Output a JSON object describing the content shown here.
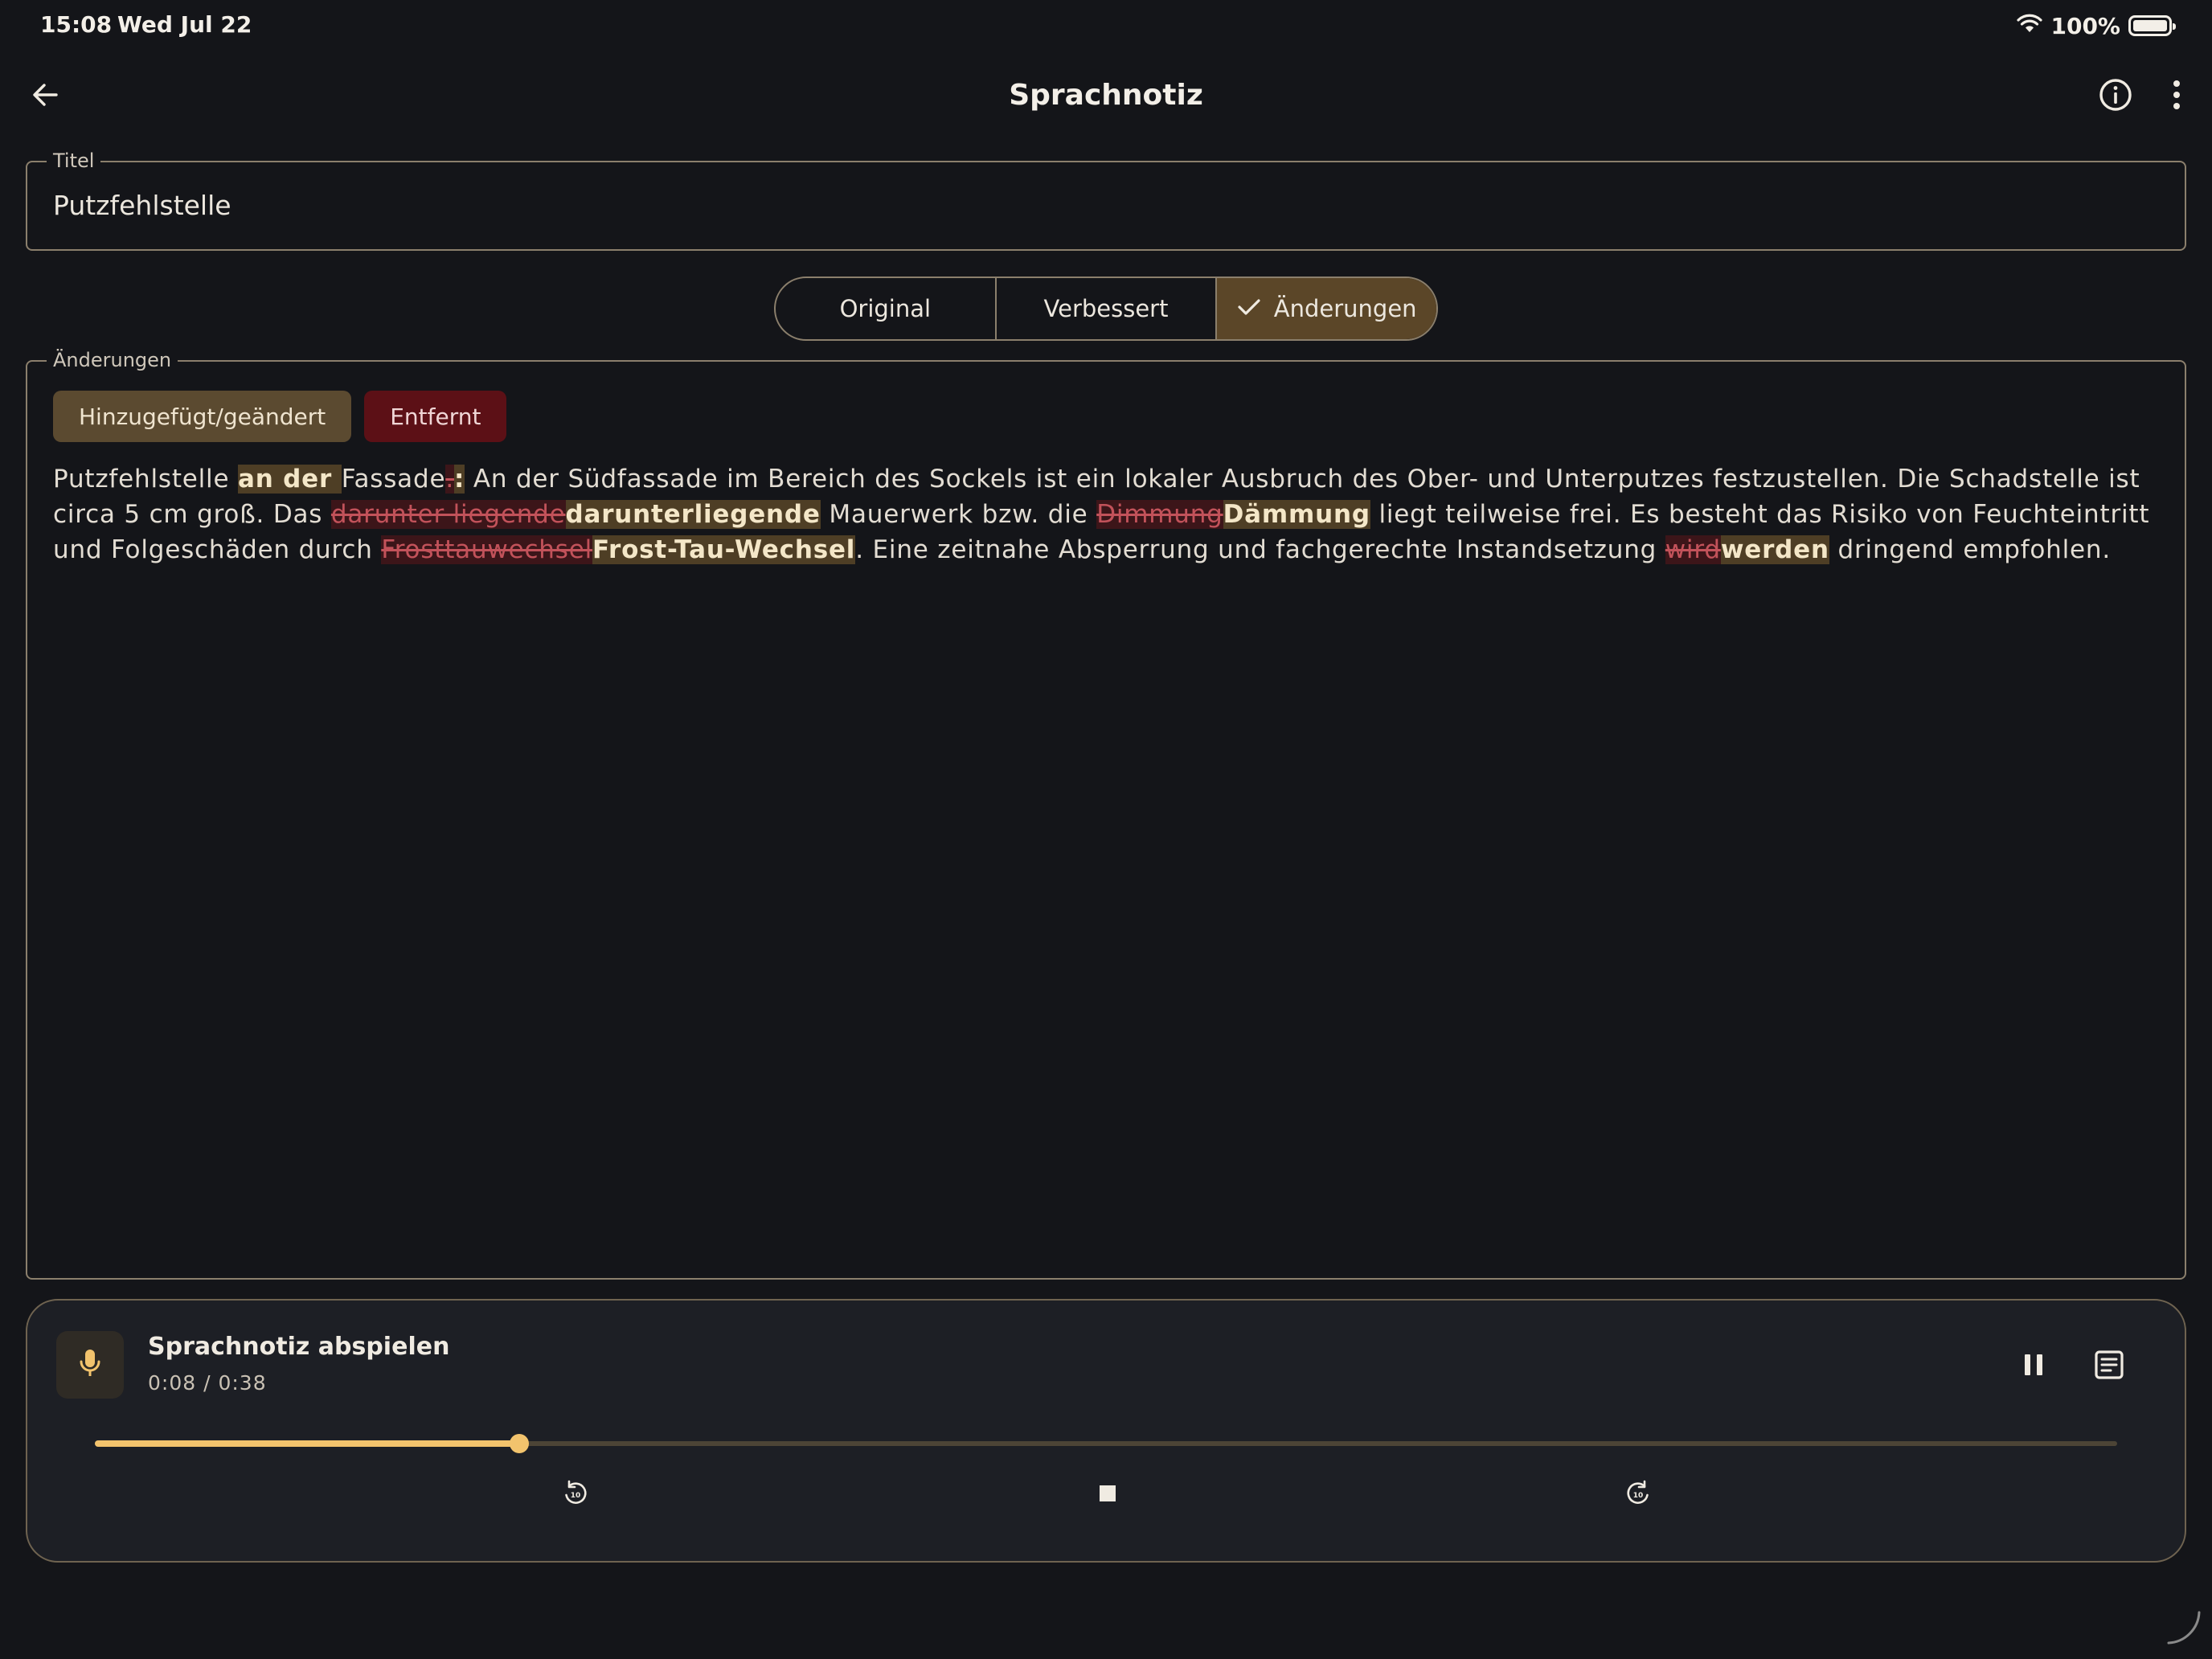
{
  "status_bar": {
    "time": "15:08",
    "date": "Wed Jul 22",
    "battery": "100%",
    "icons": [
      "wifi-icon",
      "battery-icon"
    ]
  },
  "app_bar": {
    "title": "Sprachnotiz",
    "icons": [
      "back-arrow-icon",
      "info-icon",
      "more-vertical-icon"
    ]
  },
  "title_field": {
    "label": "Titel",
    "value": "Putzfehlstelle"
  },
  "view_toggle": {
    "segments": [
      {
        "label": "Original",
        "selected": false
      },
      {
        "label": "Verbessert",
        "selected": false
      },
      {
        "label": "Änderungen",
        "selected": true
      }
    ]
  },
  "changes": {
    "label": "Änderungen",
    "legend": {
      "added": "Hinzugefügt/geändert",
      "removed": "Entfernt"
    },
    "segments": [
      {
        "type": "eq",
        "text": "Putzfehlstelle "
      },
      {
        "type": "ins",
        "text": "an der "
      },
      {
        "type": "eq",
        "text": "Fassade"
      },
      {
        "type": "del",
        "text": "."
      },
      {
        "type": "ins",
        "text": ":"
      },
      {
        "type": "eq",
        "text": " An der Südfassade im Bereich des Sockels ist ein lokaler Ausbruch des Ober- und Unterputzes festzustellen. Die Schadstelle ist circa 5 cm groß. Das "
      },
      {
        "type": "del",
        "text": "darunter liegende"
      },
      {
        "type": "ins",
        "text": "darunterliegende"
      },
      {
        "type": "eq",
        "text": " Mauerwerk bzw. die "
      },
      {
        "type": "del",
        "text": "Dimmung"
      },
      {
        "type": "ins",
        "text": "Dämmung"
      },
      {
        "type": "eq",
        "text": " liegt teilweise frei. Es besteht das Risiko von Feuchteintritt und Folgeschäden durch "
      },
      {
        "type": "del",
        "text": "Frosttauwechsel"
      },
      {
        "type": "ins",
        "text": "Frost-Tau-Wechsel"
      },
      {
        "type": "eq",
        "text": ". Eine zeitnahe Absperrung und fachgerechte Instandsetzung "
      },
      {
        "type": "del",
        "text": "wird"
      },
      {
        "type": "ins",
        "text": "werden"
      },
      {
        "type": "eq",
        "text": " dringend empfohlen."
      }
    ]
  },
  "player": {
    "title": "Sprachnotiz abspielen",
    "time": "0:08 / 0:38",
    "progress": 0.21,
    "icons": [
      "microphone-icon",
      "pause-icon",
      "transcript-icon",
      "rewind-10-icon",
      "stop-icon",
      "forward-10-icon"
    ]
  },
  "colors": {
    "background": "#141519",
    "accent": "#f2c36d",
    "added_bg": "#4e3e25",
    "removed_bg": "#3c1519",
    "removed_text": "#c2525a",
    "segment_active": "#5b4628"
  }
}
